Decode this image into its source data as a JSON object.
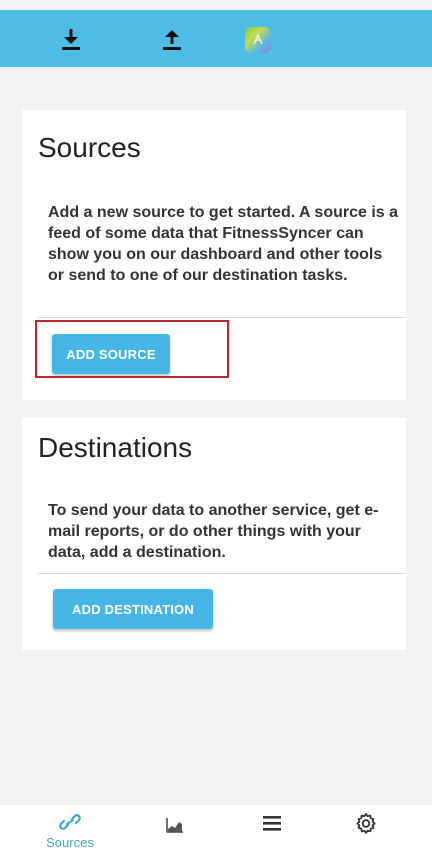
{
  "topbar": {
    "icons": [
      "download-icon",
      "upload-icon",
      "app-logo-icon"
    ],
    "background_color": "#4dbde7"
  },
  "sources_card": {
    "title": "Sources",
    "description": "Add a new source to get started. A source is a feed of some data that FitnessSyncer can show you on our dashboard and other tools or send to one of our destination tasks.",
    "button_label": "ADD SOURCE"
  },
  "destinations_card": {
    "title": "Destinations",
    "description": "To send your data to another service, get e-mail reports, or do other things with your data, add a destination.",
    "button_label": "ADD DESTINATION"
  },
  "bottom_nav": {
    "items": [
      {
        "icon": "link-icon",
        "label": "Sources",
        "active": true
      },
      {
        "icon": "chart-icon",
        "active": false
      },
      {
        "icon": "menu-icon",
        "active": false
      },
      {
        "icon": "gear-icon",
        "active": false
      }
    ],
    "active_color": "#3aa3d9"
  },
  "colors": {
    "accent": "#45b5e5",
    "highlight": "#c0282d"
  }
}
